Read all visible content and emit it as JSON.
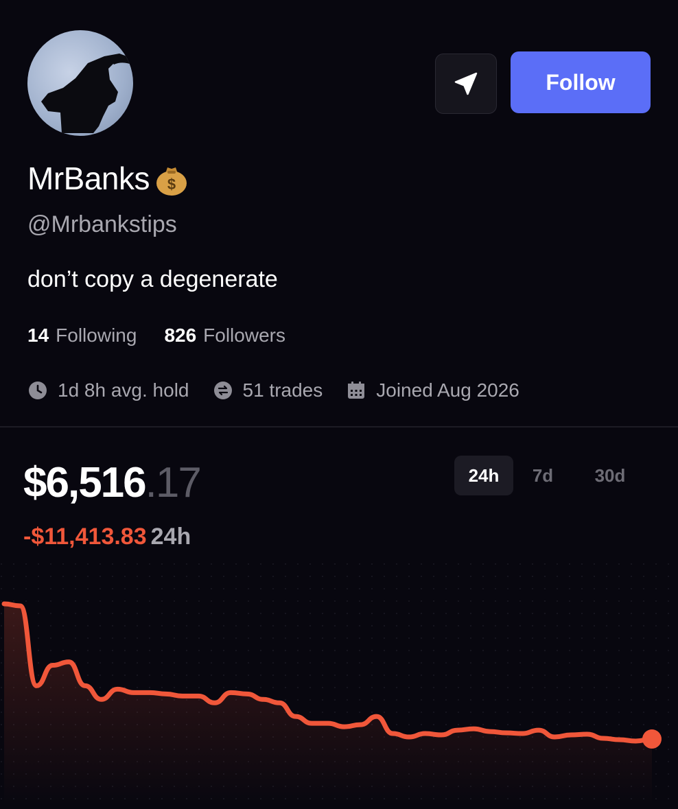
{
  "profile": {
    "name": "MrBanks",
    "handle": "@Mrbankstips",
    "bio": "don’t copy a degenerate",
    "following_count": "14",
    "following_label": "Following",
    "followers_count": "826",
    "followers_label": "Followers",
    "avg_hold": "1d 8h avg. hold",
    "trades": "51 trades",
    "joined": "Joined Aug 2026"
  },
  "actions": {
    "follow_label": "Follow"
  },
  "portfolio": {
    "balance_main": "$6,516",
    "balance_cents": ".17",
    "change_value": "-$11,413.83",
    "change_period": "24h",
    "tabs": [
      {
        "label": "24h",
        "active": true
      },
      {
        "label": "7d",
        "active": false
      },
      {
        "label": "30d",
        "active": false
      }
    ]
  },
  "colors": {
    "accent": "#5b6ef7",
    "negative": "#f0573a",
    "background": "#08070f"
  },
  "chart_data": {
    "type": "line",
    "x": [
      0,
      1,
      2,
      3,
      4,
      5,
      6,
      7,
      8,
      9,
      10,
      11,
      12,
      13,
      14,
      15,
      16,
      17,
      18,
      19,
      20,
      21,
      22,
      23,
      24,
      25,
      26,
      27,
      28,
      29,
      30,
      31,
      32,
      33,
      34,
      35,
      36,
      37,
      38,
      39,
      40
    ],
    "values": [
      6.75,
      6.72,
      5.55,
      5.85,
      5.9,
      5.55,
      5.35,
      5.5,
      5.45,
      5.45,
      5.43,
      5.4,
      5.4,
      5.3,
      5.45,
      5.43,
      5.35,
      5.3,
      5.1,
      5.0,
      5.0,
      4.95,
      4.98,
      5.1,
      4.85,
      4.8,
      4.85,
      4.83,
      4.9,
      4.92,
      4.88,
      4.86,
      4.85,
      4.9,
      4.8,
      4.83,
      4.84,
      4.78,
      4.76,
      4.74,
      4.77
    ],
    "series_color": "#f0573a"
  }
}
